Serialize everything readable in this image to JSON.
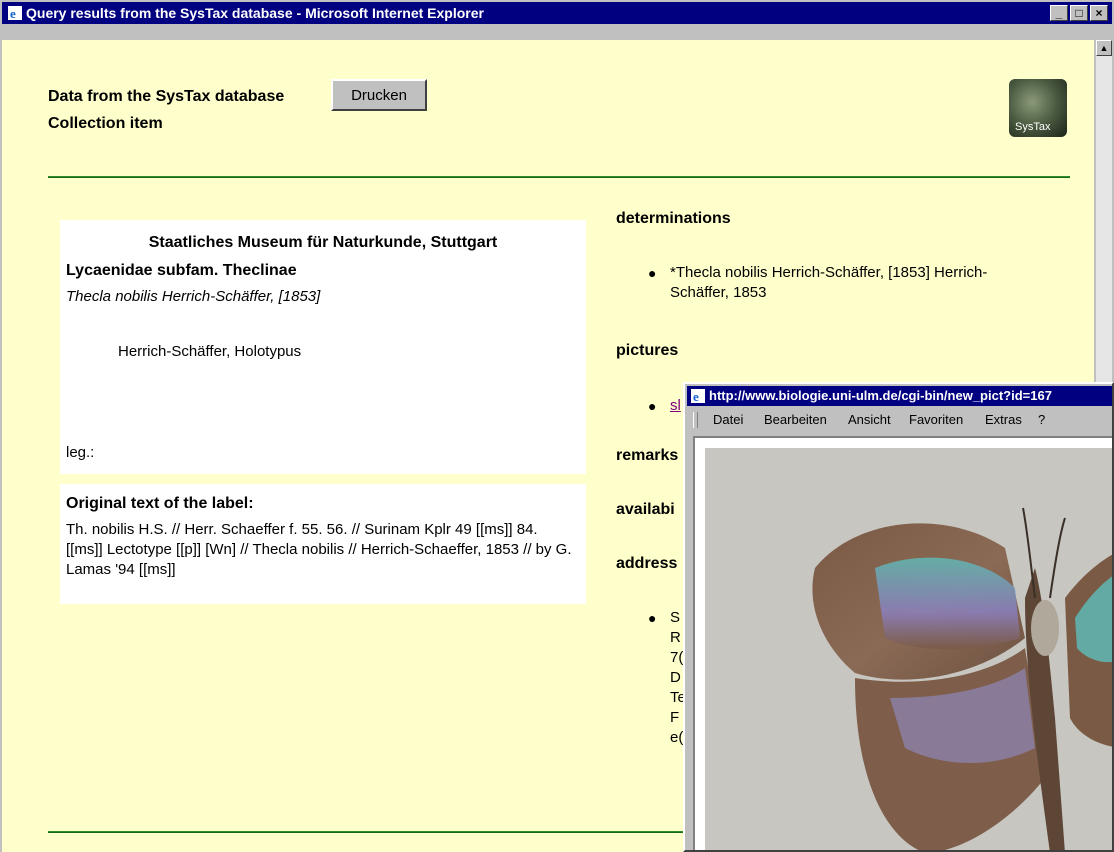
{
  "window": {
    "title": "Query results from the SysTax database - Microsoft Internet Explorer",
    "minimize": "_",
    "maximize": "□",
    "close": "×"
  },
  "header": {
    "line1": "Data from the SysTax database",
    "line2": "Collection item",
    "print_button": "Drucken",
    "logo_text": "SysTax"
  },
  "label": {
    "museum": "Staatliches Museum für Naturkunde, Stuttgart",
    "family": "Lycaenidae subfam. Theclinae",
    "species": "Thecla nobilis Herrich-Schäffer, [1853]",
    "type_status": "Herrich-Schäffer, Holotypus",
    "leg": "leg.:"
  },
  "original_label": {
    "title": "Original text of the label:",
    "text": "Th. nobilis H.S. // Herr. Schaeffer f. 55. 56. // Surinam Kplr 49 [[ms]] 84. [[ms]] Lectotype [[p]] [Wn] // Thecla nobilis // Herrich-Schaeffer, 1853 // by G. Lamas '94 [[ms]]"
  },
  "sections": {
    "determinations": "determinations",
    "determination_item_line1": "*Thecla nobilis Herrich-Schäffer, [1853] Herrich-",
    "determination_item_line2": "Schäffer, 1853",
    "pictures": "pictures",
    "picture_link": "sl",
    "remarks": "remarks",
    "availability": "availabi",
    "address": "address",
    "address_fragments": [
      "S",
      "R",
      "7(",
      "D",
      "Te",
      "F",
      "e("
    ]
  },
  "popup": {
    "title": "http://www.biologie.uni-ulm.de/cgi-bin/new_pict?id=167",
    "menu": [
      "Datei",
      "Bearbeiten",
      "Ansicht",
      "Favoriten",
      "Extras",
      "?"
    ]
  },
  "colors": {
    "page_bg": "#ffffcc",
    "titlebar": "#000080",
    "rule": "#2e8b2e",
    "visited_link": "#800080"
  }
}
